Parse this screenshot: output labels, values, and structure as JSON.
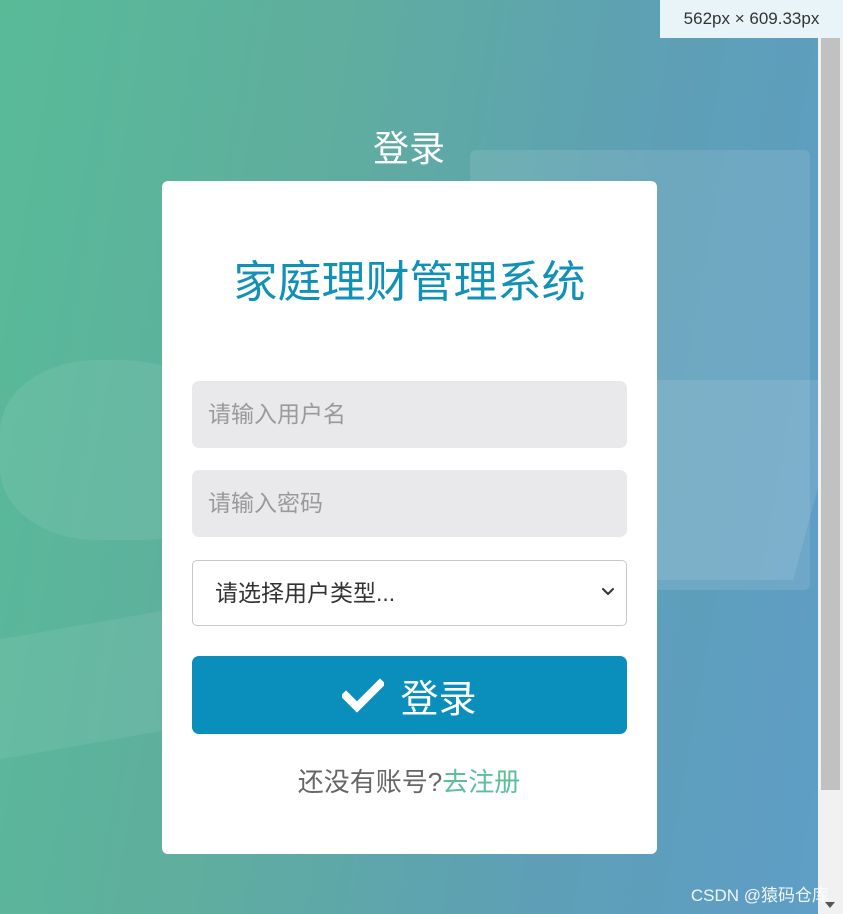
{
  "page": {
    "heading": "登录",
    "dimensions_label": "562px × 609.33px",
    "watermark": "CSDN @猿码仓库"
  },
  "form": {
    "system_title": "家庭理财管理系统",
    "username_placeholder": "请输入用户名",
    "password_placeholder": "请输入密码",
    "user_type_selected": "请选择用户类型...",
    "login_button_label": "登录",
    "register_prompt": "还没有账号?",
    "register_link": "去注册"
  },
  "colors": {
    "accent": "#0a8ebc",
    "title": "#1190b8",
    "link": "#5bbf9a"
  },
  "icons": [
    "check-icon",
    "chevron-down-icon"
  ]
}
